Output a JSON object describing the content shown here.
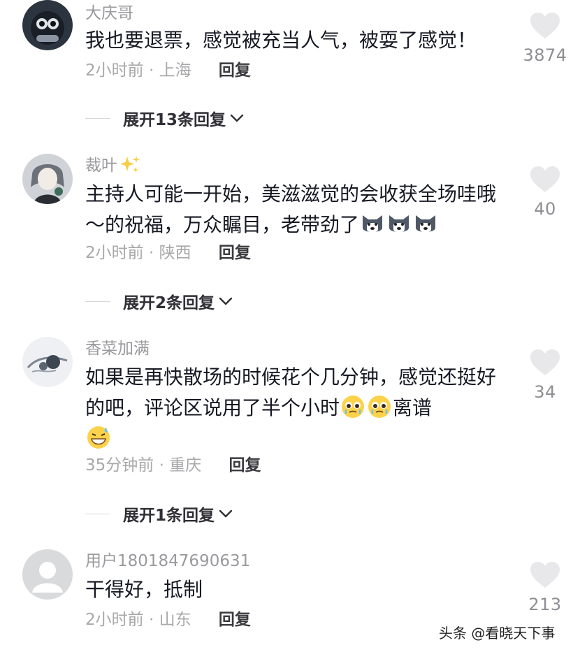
{
  "comments": [
    {
      "username": "大庆哥",
      "text": "我也要退票，感觉被充当人气，被耍了感觉！",
      "time": "2小时前",
      "location": "上海",
      "reply_label": "回复",
      "likes": "3874",
      "expand_label": "展开13条回复"
    },
    {
      "username": "裁叶",
      "text_part": "主持人可能一开始，美滋滋觉的会收获全场哇哦～的祝福，万众瞩目，老带劲了",
      "time": "2小时前",
      "location": "陕西",
      "reply_label": "回复",
      "likes": "40",
      "expand_label": "展开2条回复"
    },
    {
      "username": "香菜加满",
      "text_part1": "如果是再快散场的时候花个几分钟，感觉还挺好的吧，评论区说用了半个小时",
      "text_part2": "离谱",
      "time": "35分钟前",
      "location": "重庆",
      "reply_label": "回复",
      "likes": "34",
      "expand_label": "展开1条回复"
    },
    {
      "username": "用户1801847690631",
      "text": "干得好，抵制",
      "time": "2小时前",
      "location": "山东",
      "reply_label": "回复",
      "likes": "213"
    }
  ],
  "meta_separator": "·",
  "watermark": "头条 @看晓天下事",
  "colors": {
    "heart": "#e8e8ea",
    "username": "#9a9a9e",
    "text": "#161823"
  }
}
